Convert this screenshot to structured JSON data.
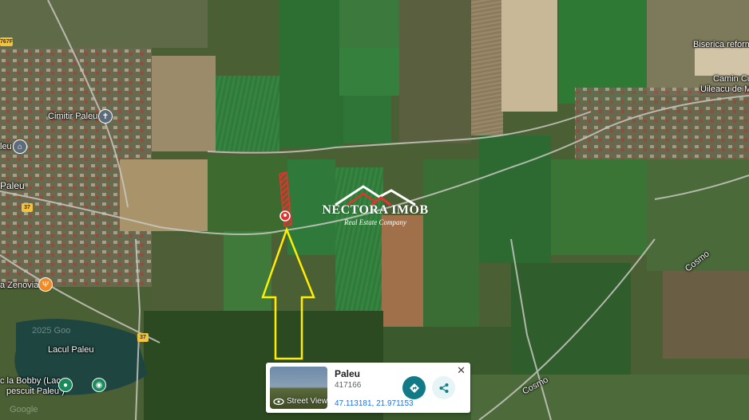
{
  "map": {
    "labels": {
      "cemetery": "Cimitir Paleu",
      "paleu_left": "Paleu",
      "paleu_left2": "leu",
      "church": "Biserica reform",
      "camin": "Camin Cul",
      "uileacu": "Uileacu de M",
      "zenovia": "a Zenovia",
      "lake": "Lacul Paleu",
      "bobby1": "c la Bobby (Lac",
      "bobby2": "pescuit Paleu )",
      "cosmo_1": "Cosmo",
      "cosmo_2": "Cosmo",
      "road_37a": "37",
      "road_37b": "37",
      "road_767": "767F",
      "faded_year": "2025 Goo",
      "faded_google": "Google"
    }
  },
  "watermark": {
    "title": "NECTORA IMOB",
    "subtitle": "Real Estate Company"
  },
  "place_card": {
    "name": "Paleu",
    "postal_code": "417166",
    "coordinates": "47.113181, 21.971153",
    "street_view_label": "Street View",
    "close_symbol": "✕"
  },
  "colors": {
    "arrow": "#ffee00",
    "parcel": "#e2342f",
    "accent_button": "#127a86",
    "secondary_button": "#e6f4f6"
  },
  "icons": [
    "cemetery-icon",
    "museum-icon",
    "restaurant-icon",
    "location-pin-icon",
    "park-icon",
    "directions-icon",
    "share-icon",
    "street-view-icon",
    "close-icon",
    "parcel-pin-icon"
  ]
}
